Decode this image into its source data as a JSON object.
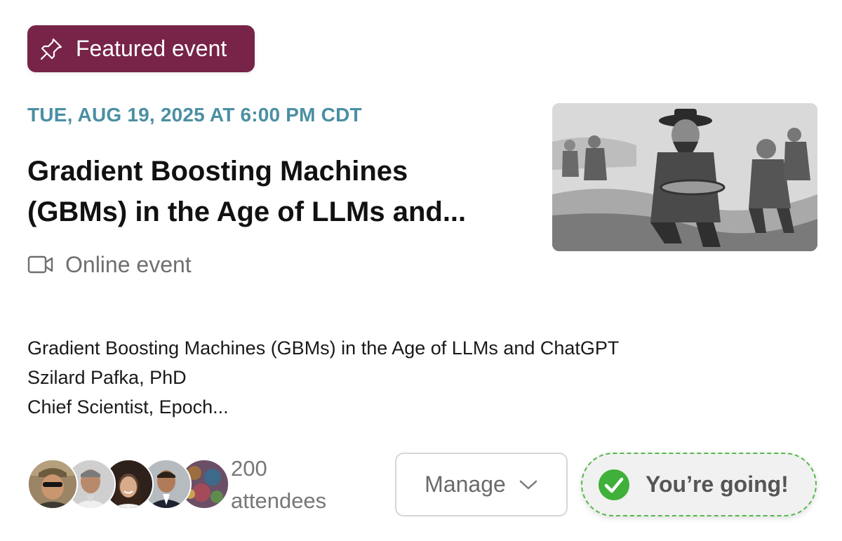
{
  "badge": {
    "label": "Featured event",
    "icon": "pin-icon",
    "color": "#772448"
  },
  "event": {
    "date": "TUE, AUG 19, 2025 AT 6:00 PM CDT",
    "title_line1": "Gradient Boosting Machines",
    "title_line2": "(GBMs) in the Age of LLMs and...",
    "location": "Online event",
    "location_icon": "video-camera-icon",
    "description": [
      "Gradient Boosting Machines (GBMs) in the Age of LLMs and ChatGPT",
      "Szilard Pafka, PhD",
      "Chief Scientist, Epoch..."
    ]
  },
  "attendees": {
    "count": "200",
    "label": "attendees"
  },
  "actions": {
    "manage_label": "Manage",
    "going_label": "You’re going!",
    "going_color": "#54b94a"
  },
  "colors": {
    "date": "#4b8fa3",
    "accent": "#772448"
  }
}
